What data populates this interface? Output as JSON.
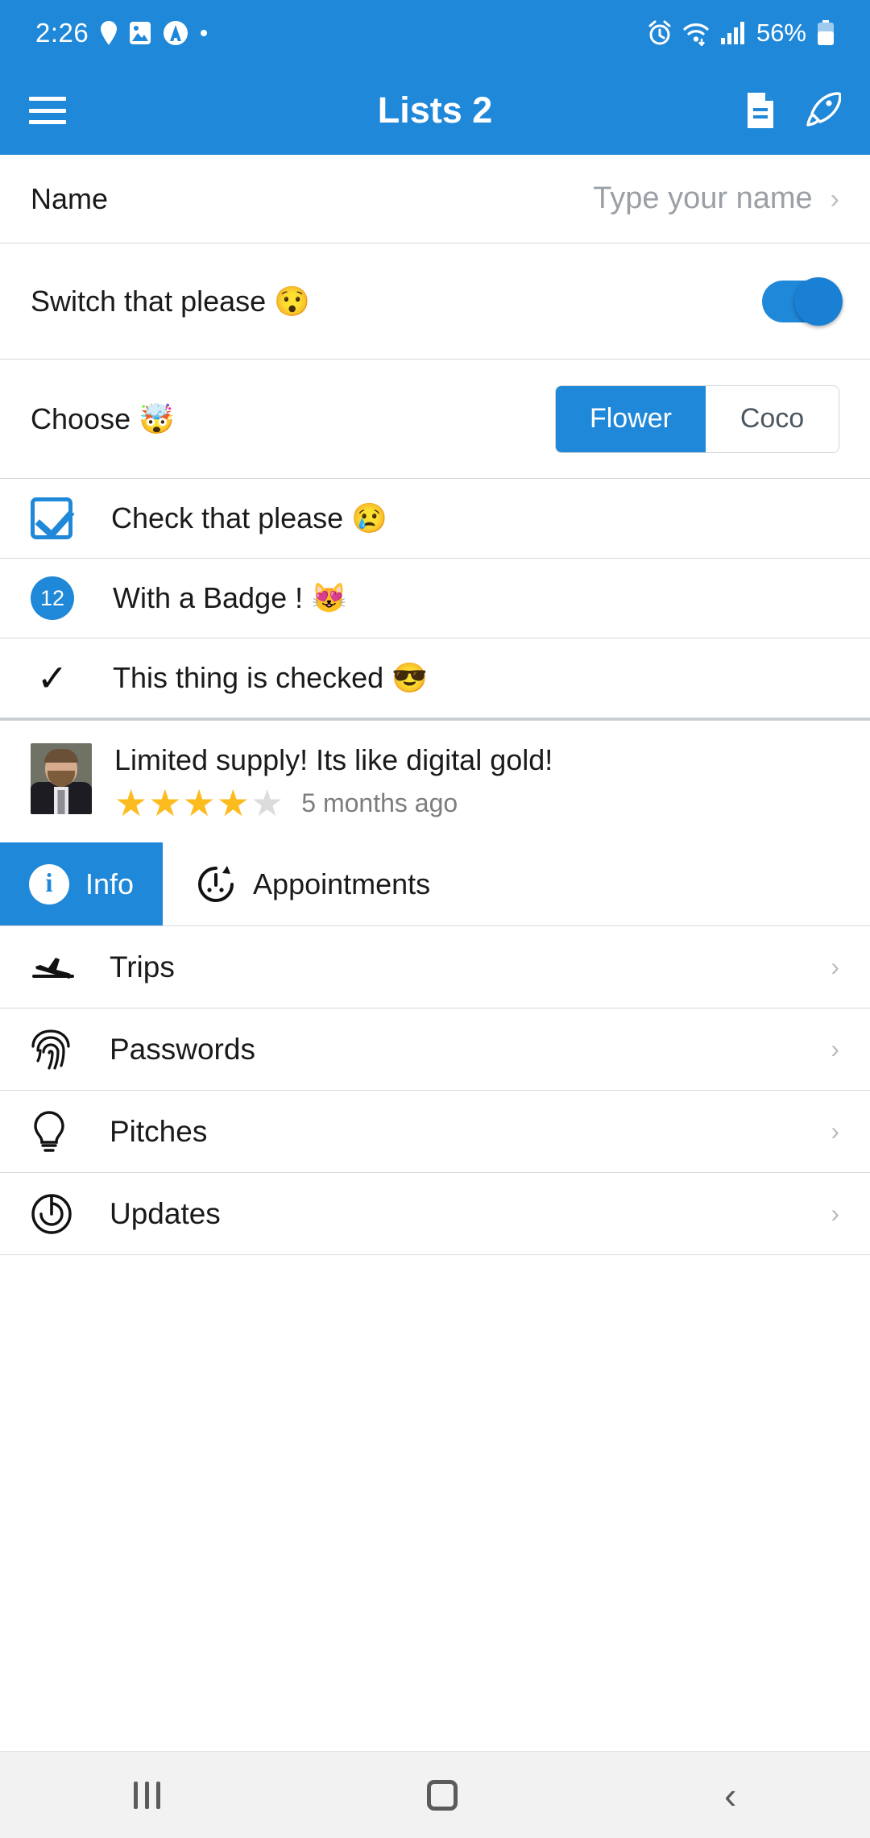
{
  "status_bar": {
    "time": "2:26",
    "battery_percent": "56%",
    "left_icons": [
      "location-pin-icon",
      "image-icon",
      "circle-a-icon",
      "dot-icon"
    ],
    "right_icons": [
      "alarm-icon",
      "wifi-icon",
      "signal-icon",
      "battery-icon"
    ]
  },
  "app_bar": {
    "menu_icon": "hamburger-menu-icon",
    "title": "Lists 2",
    "actions": [
      "document-icon",
      "rocket-icon"
    ]
  },
  "theme": {
    "accent": "#2088d8",
    "star_on": "#fcbb1f",
    "star_off": "#dcdcdc",
    "divider": "#d8d8d8"
  },
  "rows": {
    "name": {
      "label": "Name",
      "placeholder": "Type your name",
      "value": "",
      "chevron": "›"
    },
    "switch": {
      "label": "Switch that please 😯",
      "state": "on"
    },
    "choose": {
      "label": "Choose 🤯",
      "options": [
        "Flower",
        "Coco"
      ],
      "selected": "Flower"
    },
    "check": {
      "label": "Check that please 😢",
      "checked": true
    },
    "badge": {
      "badge_value": "12",
      "label": "With a Badge ! 😻"
    },
    "tick": {
      "label": "This thing is checked 😎",
      "mark": "✓"
    }
  },
  "review": {
    "title": "Limited supply! Its like digital gold!",
    "rating": 4,
    "max_rating": 5,
    "time": "5 months ago",
    "avatar": "user-photo"
  },
  "tabs": [
    {
      "label": "Info",
      "icon": "info-icon",
      "active": true
    },
    {
      "label": "Appointments",
      "icon": "clock-icon",
      "active": false
    }
  ],
  "list_items": [
    {
      "label": "Trips",
      "icon": "airplane-landing-icon",
      "chevron": "›"
    },
    {
      "label": "Passwords",
      "icon": "fingerprint-icon",
      "chevron": "›"
    },
    {
      "label": "Pitches",
      "icon": "lightbulb-icon",
      "chevron": "›"
    },
    {
      "label": "Updates",
      "icon": "power-update-icon",
      "chevron": "›"
    }
  ],
  "nav_bar": {
    "recents": "recents-icon",
    "home": "home-icon",
    "back": "back-icon"
  }
}
